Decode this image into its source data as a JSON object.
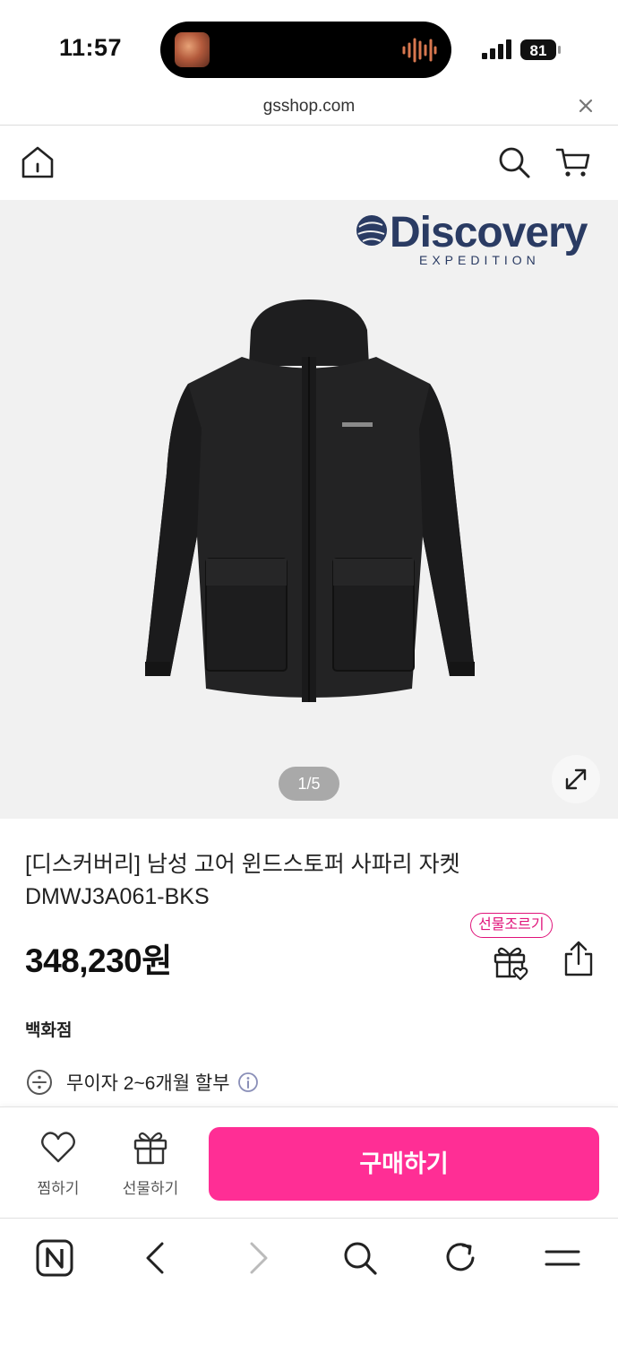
{
  "status_bar": {
    "time": "11:57",
    "battery": "81"
  },
  "browser": {
    "url": "gsshop.com"
  },
  "header": {
    "icons": [
      "home-icon",
      "search-icon",
      "cart-icon"
    ]
  },
  "gallery": {
    "brand_name": "Discovery",
    "brand_sub": "EXPEDITION",
    "pager": "1/5"
  },
  "product": {
    "title": "[디스커버리] 남성 고어 윈드스토퍼 사파리 자켓 DMWJ3A061-BKS",
    "price": "348,230원",
    "gift_badge": "선물조르기",
    "department": "백화점",
    "installment": "무이자 2~6개월 할부"
  },
  "action_bar": {
    "wish_label": "찜하기",
    "gift_label": "선물하기",
    "buy_label": "구매하기"
  },
  "colors": {
    "accent": "#ff2e95",
    "badge": "#e0137a"
  }
}
